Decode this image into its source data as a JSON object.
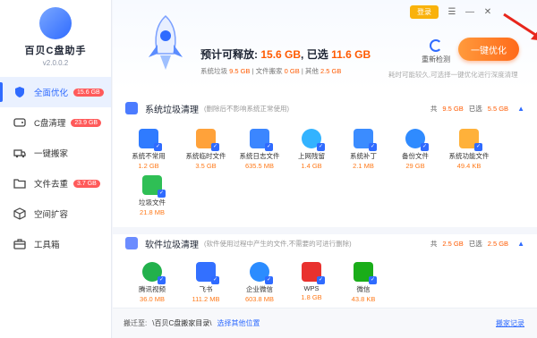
{
  "app": {
    "name": "百贝C盘助手",
    "version": "v2.0.0.2"
  },
  "sidebar": {
    "items": [
      {
        "label": "全面优化",
        "badge": "15.6 GB",
        "icon": "shield-icon"
      },
      {
        "label": "C盘清理",
        "badge": "23.9 GB",
        "icon": "drive-icon"
      },
      {
        "label": "一键搬家",
        "badge": "",
        "icon": "truck-icon"
      },
      {
        "label": "文件去重",
        "badge": "3.7 GB",
        "icon": "folder-icon"
      },
      {
        "label": "空间扩容",
        "badge": "",
        "icon": "cube-icon"
      },
      {
        "label": "工具箱",
        "badge": "",
        "icon": "toolbox-icon"
      }
    ]
  },
  "topbar": {
    "login": "登录"
  },
  "hero": {
    "title_prefix": "预计可释放:",
    "releasable": "15.6 GB",
    "selected_label": "已选",
    "selected": "11.6 GB",
    "stats_system_label": "系统垃圾",
    "stats_system": "9.5 GB",
    "stats_move_label": "文件搬家",
    "stats_move": "0 GB",
    "stats_other_label": "其他",
    "stats_other": "2.5 GB",
    "rescan": "重新检测",
    "optimize": "一键优化",
    "hint": "耗时可能较久,可选择一键优化进行深度清理"
  },
  "section1": {
    "title": "系统垃圾清理",
    "desc": "(删除后不影响系统正常使用)",
    "total_label": "共",
    "total": "9.5 GB",
    "selected_label": "已选",
    "selected": "5.5 GB",
    "items": [
      {
        "name": "系统不常用",
        "size": "1.2 GB",
        "color": "#2f7bff"
      },
      {
        "name": "系统临时文件",
        "size": "3.5 GB",
        "color": "#ffa23a"
      },
      {
        "name": "系统日志文件",
        "size": "635.5 MB",
        "color": "#3b86ff"
      },
      {
        "name": "上网残留",
        "size": "1.4 GB",
        "color": "#33b3ff"
      },
      {
        "name": "系统补丁",
        "size": "2.1 MB",
        "color": "#3b8cff"
      },
      {
        "name": "备份文件",
        "size": "29 GB",
        "color": "#2f8bff"
      },
      {
        "name": "系统功能文件",
        "size": "49.4 KB",
        "color": "#ffb13a"
      },
      {
        "name": "垃圾文件",
        "size": "21.8 MB",
        "color": "#2fbf55"
      }
    ]
  },
  "section2": {
    "title": "软件垃圾清理",
    "desc": "(软件使用过程中产生的文件,不需要的可进行删除)",
    "total_label": "共",
    "total": "2.5 GB",
    "selected_label": "已选",
    "selected": "2.5 GB",
    "items": [
      {
        "name": "腾讯视频",
        "size": "36.0 MB",
        "color": "#22b14c"
      },
      {
        "name": "飞书",
        "size": "111.2 MB",
        "color": "#3370ff"
      },
      {
        "name": "企业微信",
        "size": "603.8 MB",
        "color": "#2b8cff"
      },
      {
        "name": "WPS",
        "size": "1.8 GB",
        "color": "#e9312e"
      },
      {
        "name": "微信",
        "size": "43.8 KB",
        "color": "#1aad19"
      }
    ]
  },
  "footer": {
    "label": "搬迁至:",
    "path": "\\百贝C盘搬家目录\\",
    "choose": "选择其他位置",
    "records": "搬家记录"
  }
}
